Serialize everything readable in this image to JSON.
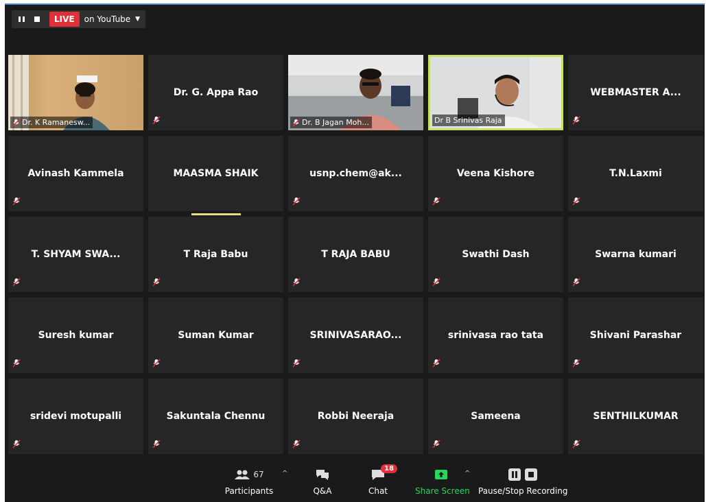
{
  "live": {
    "badge": "LIVE",
    "destination": "on YouTube",
    "live_color": "#e0303a"
  },
  "participants_grid": [
    {
      "name": "Dr. K Ramanesw...",
      "video": true,
      "muted": true
    },
    {
      "name": "Dr. G. Appa Rao",
      "video": false,
      "muted": true
    },
    {
      "name": "Dr. B Jagan Moh...",
      "video": true,
      "muted": true
    },
    {
      "name": "Dr B Srinivas Raja",
      "video": true,
      "muted": false,
      "active_speaker": true
    },
    {
      "name": "WEBMASTER A...",
      "video": false,
      "muted": true
    },
    {
      "name": "Avinash Kammela",
      "video": false,
      "muted": true
    },
    {
      "name": "MAASMA SHAIK",
      "video": false,
      "muted": false,
      "speaking": true
    },
    {
      "name": "usnp.chem@ak...",
      "video": false,
      "muted": true
    },
    {
      "name": "Veena Kishore",
      "video": false,
      "muted": true
    },
    {
      "name": "T.N.Laxmi",
      "video": false,
      "muted": true
    },
    {
      "name": "T. SHYAM SWA...",
      "video": false,
      "muted": true
    },
    {
      "name": "T Raja Babu",
      "video": false,
      "muted": true
    },
    {
      "name": "T RAJA BABU",
      "video": false,
      "muted": true
    },
    {
      "name": "Swathi Dash",
      "video": false,
      "muted": true
    },
    {
      "name": "Swarna kumari",
      "video": false,
      "muted": true
    },
    {
      "name": "Suresh kumar",
      "video": false,
      "muted": true
    },
    {
      "name": "Suman Kumar",
      "video": false,
      "muted": true
    },
    {
      "name": "SRINIVASARAO...",
      "video": false,
      "muted": true
    },
    {
      "name": "srinivasa rao tata",
      "video": false,
      "muted": true
    },
    {
      "name": "Shivani Parashar",
      "video": false,
      "muted": true
    },
    {
      "name": "sridevi motupalli",
      "video": false,
      "muted": true
    },
    {
      "name": "Sakuntala Chennu",
      "video": false,
      "muted": true
    },
    {
      "name": "Robbi Neeraja",
      "video": false,
      "muted": true
    },
    {
      "name": "Sameena",
      "video": false,
      "muted": true
    },
    {
      "name": "SENTHILKUMAR",
      "video": false,
      "muted": true
    }
  ],
  "toolbar": {
    "participants": {
      "label": "Participants",
      "count": "67",
      "icon": "participants-icon"
    },
    "qa": {
      "label": "Q&A",
      "icon": "qa-icon"
    },
    "chat": {
      "label": "Chat",
      "badge": "18",
      "icon": "chat-icon"
    },
    "share": {
      "label": "Share Screen",
      "icon": "share-screen-icon",
      "color": "#23d959"
    },
    "recording": {
      "label": "Pause/Stop Recording",
      "icon": "pause-stop-icon"
    }
  }
}
